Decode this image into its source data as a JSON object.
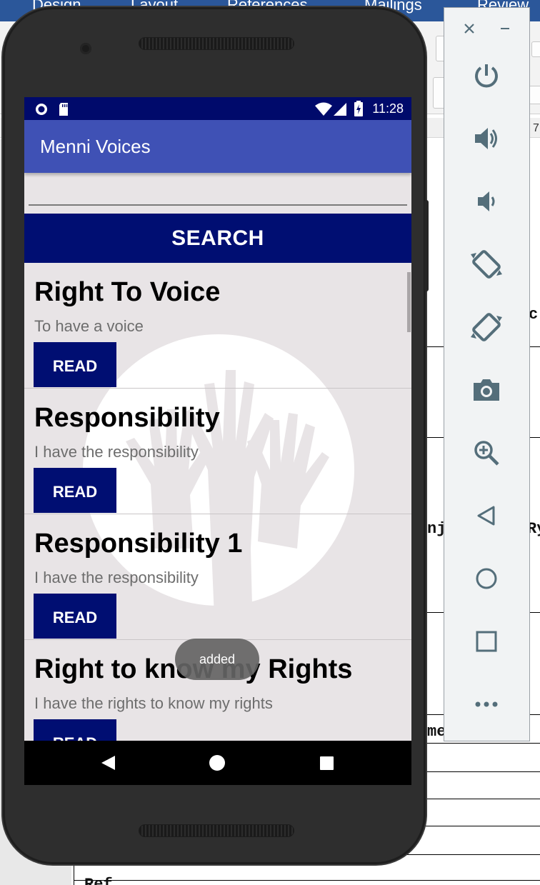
{
  "word": {
    "tabs": [
      "Design",
      "Layout",
      "References",
      "Mailings",
      "Review"
    ],
    "ruler_number": "7",
    "fragments": [
      "c",
      "nj",
      "Ry",
      "me",
      "Ref"
    ]
  },
  "status_bar": {
    "time": "11:28"
  },
  "app": {
    "title": "Menni Voices",
    "search_placeholder": "",
    "search_button": "SEARCH"
  },
  "rights": [
    {
      "title": "Right To Voice",
      "description": "To have a voice",
      "button": "READ"
    },
    {
      "title": "Responsibility",
      "description": "I have the responsibility",
      "button": "READ"
    },
    {
      "title": "Responsibility 1",
      "description": "I have the responsibility",
      "button": "READ"
    },
    {
      "title": "Right to know my Rights",
      "description": "I have the rights to know my rights",
      "button": "READ"
    }
  ],
  "toast": "added",
  "nav": {
    "back": "back-icon",
    "home": "home-icon",
    "recents": "recents-icon"
  },
  "emulator_toolbar": {
    "buttons": [
      "close-icon",
      "minimize-icon",
      "power-icon",
      "volume-up-icon",
      "volume-down-icon",
      "rotate-left-icon",
      "rotate-right-icon",
      "camera-icon",
      "zoom-icon",
      "back-icon",
      "home-icon",
      "overview-icon",
      "more-icon"
    ]
  },
  "colors": {
    "app_bar": "#3f51b5",
    "status_bar": "#000a6b",
    "primary_dark": "#000e72",
    "list_background": "#e8e4e6",
    "toolbar_icon": "#546e7a"
  }
}
